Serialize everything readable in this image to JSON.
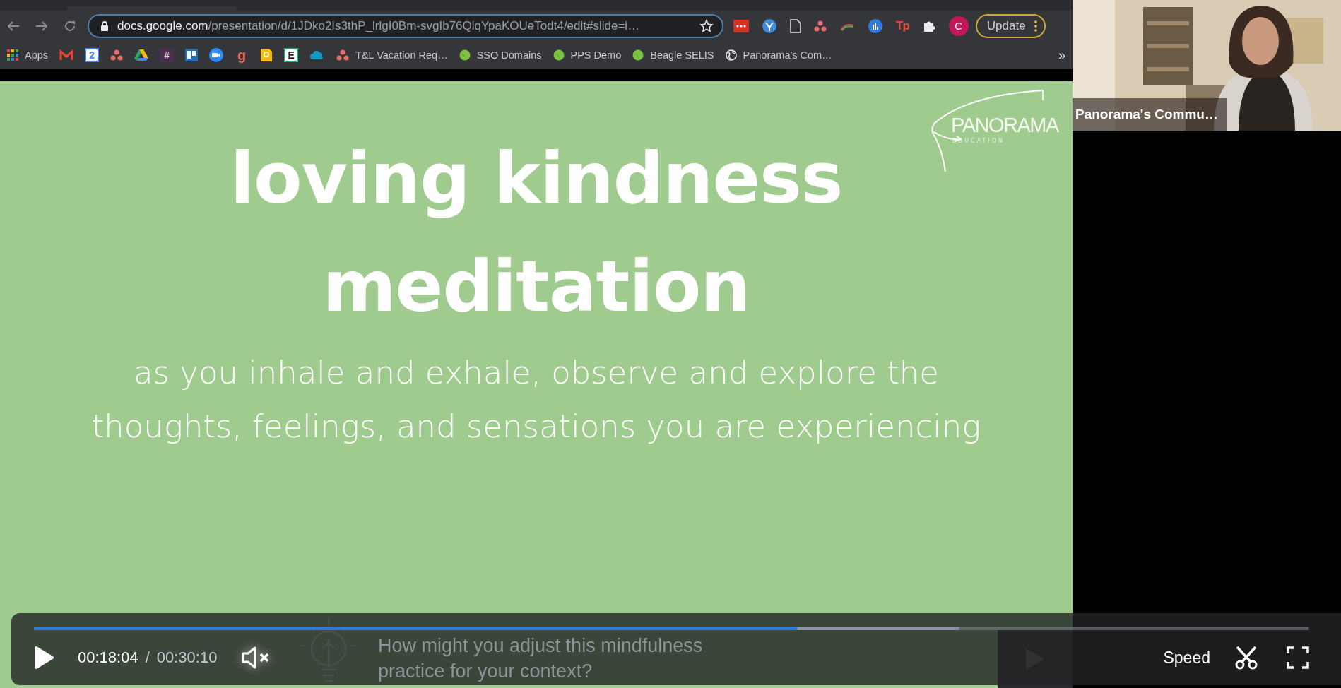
{
  "toolbar": {
    "url": {
      "host": "docs.google.com",
      "path": "/presentation/d/1JDko2Is3thP_lrlgI0Bm-svgIb76QiqYpaKOUeTodt4/edit#slide=i…"
    },
    "extensions": [
      {
        "kind": "red-dots"
      },
      {
        "kind": "blue-y"
      },
      {
        "kind": "doc"
      },
      {
        "kind": "asana"
      },
      {
        "kind": "rainbow"
      },
      {
        "kind": "chart"
      },
      {
        "kind": "text-logo",
        "glyph": "Tp"
      },
      {
        "kind": "puzzle"
      }
    ],
    "profile": {
      "initial": "C"
    },
    "update_button": "Update"
  },
  "bookmarks": [
    {
      "kind": "apps",
      "label": "Apps"
    },
    {
      "kind": "gmail"
    },
    {
      "kind": "calendar",
      "glyph": "2"
    },
    {
      "kind": "asana"
    },
    {
      "kind": "drive"
    },
    {
      "kind": "slack",
      "glyph": "#"
    },
    {
      "kind": "trello"
    },
    {
      "kind": "zoom"
    },
    {
      "kind": "letter",
      "glyph": "g"
    },
    {
      "kind": "keep"
    },
    {
      "kind": "letter-box",
      "glyph": "E"
    },
    {
      "kind": "cloud"
    },
    {
      "kind": "asana",
      "label": "T&L Vacation Req…"
    },
    {
      "kind": "green-dot",
      "label": "SSO Domains"
    },
    {
      "kind": "green-dot",
      "label": "PPS Demo"
    },
    {
      "kind": "green-dot",
      "label": "Beagle SELIS"
    },
    {
      "kind": "globe",
      "label": "Panorama's Com…"
    }
  ],
  "bookmarks_overflow": "»",
  "slide": {
    "logo": {
      "name": "PANORAMA",
      "tagline": "EDUCATION"
    },
    "title_lines": [
      "loving kindness",
      "meditation"
    ],
    "subtitle_lines": [
      "as you inhale and exhale, observe and explore the",
      "thoughts, feelings, and sensations you are experiencing"
    ],
    "note_lines": [
      "How might you adjust this mindfulness",
      "practice for your context?"
    ]
  },
  "webcam": {
    "kind": "picture",
    "name": "Panorama's Commu…"
  },
  "player": {
    "playing": false,
    "level": 0.599,
    "current_time": "00:18:04",
    "separator": "/",
    "total_time": "00:30:10",
    "muted": true,
    "speed_label": "Speed"
  }
}
